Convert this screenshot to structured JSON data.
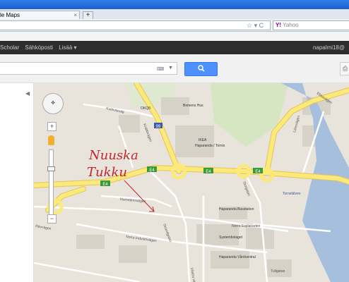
{
  "browser": {
    "tab_title": "le Maps",
    "tab_close": "×",
    "new_tab": "+",
    "search_engine_logo": "Y!",
    "search_placeholder": "Yahoo",
    "url_icons": "☆ ▾ C"
  },
  "google_bar": {
    "items": [
      "Scholar",
      "Sähköposti",
      "Lisää ▾"
    ],
    "user": "napalmi18@"
  },
  "maps": {
    "search_value": "",
    "keyboard_icon": "keyboard-icon",
    "search_button_icon": "magnifier-icon"
  },
  "map": {
    "roads": {
      "road_e4": "E4",
      "road_99": "99"
    },
    "streets": [
      "Kukkolaväg",
      "Krabbvägen",
      "Normalmsvägen",
      "Norra Industrivägen",
      "Strandgatan",
      "Rävvägen",
      "Storgatan",
      "Västra vägen",
      "Norra Esplanaden",
      "Tullgatan",
      "Länsvägen",
      "Ebbavägen"
    ],
    "places": [
      "OKQ8",
      "Bomens Hus",
      "IKEA",
      "Haparanda / Tornio",
      "Haparanda Busstation",
      "Systembolaget",
      "Haparanda Vårdcentral",
      "Tornelälven"
    ],
    "annotation": {
      "line1": "Nuuska",
      "line2": "Tukku"
    },
    "colors": {
      "land": "#e8e4dc",
      "highway": "#fbe97a",
      "water": "#a5bfdd",
      "green": "#d6e6c2",
      "annotation": "#c0272d"
    }
  }
}
